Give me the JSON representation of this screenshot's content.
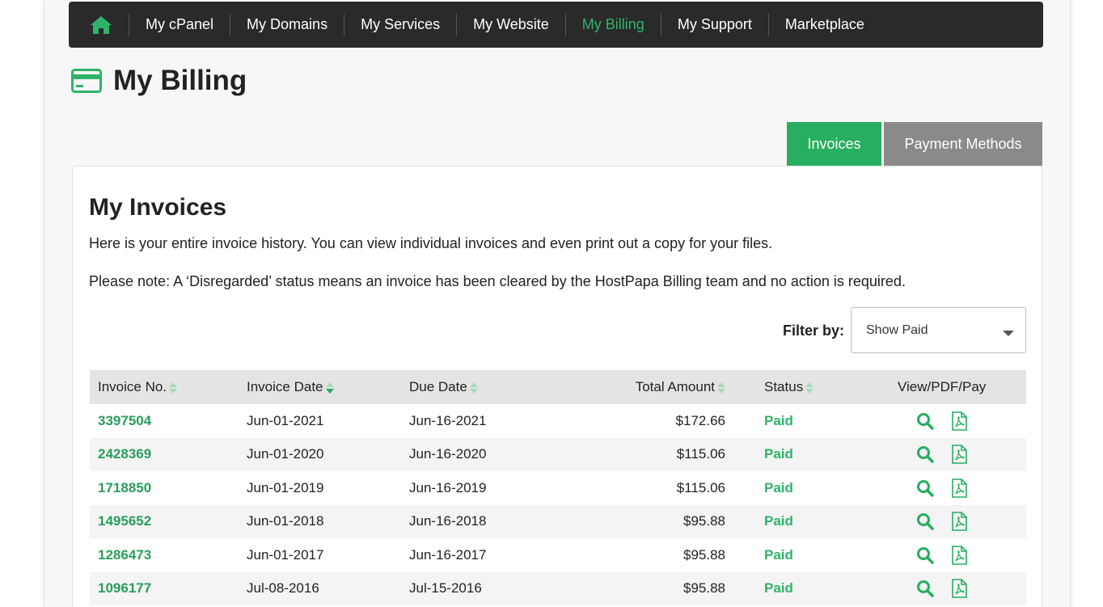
{
  "nav": {
    "home_icon": "home-icon",
    "items": [
      {
        "label": "My cPanel",
        "active": false
      },
      {
        "label": "My Domains",
        "active": false
      },
      {
        "label": "My Services",
        "active": false
      },
      {
        "label": "My Website",
        "active": false
      },
      {
        "label": "My Billing",
        "active": true
      },
      {
        "label": "My Support",
        "active": false
      },
      {
        "label": "Marketplace",
        "active": false
      }
    ]
  },
  "page": {
    "title": "My Billing",
    "icon": "credit-card-icon"
  },
  "tabs": {
    "invoices": "Invoices",
    "payment_methods": "Payment Methods"
  },
  "invoices": {
    "heading": "My Invoices",
    "description": "Here is your entire invoice history. You can view individual invoices and even print out a copy for your files.",
    "note": "Please note: A ‘Disregarded’ status means an invoice has been cleared by the HostPapa Billing team and no action is required.",
    "filter_label": "Filter by:",
    "filter_value": "Show Paid",
    "columns": {
      "invoice_no": "Invoice No.",
      "invoice_date": "Invoice Date",
      "due_date": "Due Date",
      "total_amount": "Total Amount",
      "status": "Status",
      "actions": "View/PDF/Pay"
    },
    "rows": [
      {
        "no": "3397504",
        "invoice_date": "Jun-01-2021",
        "due_date": "Jun-16-2021",
        "amount": "$172.66",
        "status": "Paid"
      },
      {
        "no": "2428369",
        "invoice_date": "Jun-01-2020",
        "due_date": "Jun-16-2020",
        "amount": "$115.06",
        "status": "Paid"
      },
      {
        "no": "1718850",
        "invoice_date": "Jun-01-2019",
        "due_date": "Jun-16-2019",
        "amount": "$115.06",
        "status": "Paid"
      },
      {
        "no": "1495652",
        "invoice_date": "Jun-01-2018",
        "due_date": "Jun-16-2018",
        "amount": "$95.88",
        "status": "Paid"
      },
      {
        "no": "1286473",
        "invoice_date": "Jun-01-2017",
        "due_date": "Jun-16-2017",
        "amount": "$95.88",
        "status": "Paid"
      },
      {
        "no": "1096177",
        "invoice_date": "Jul-08-2016",
        "due_date": "Jul-15-2016",
        "amount": "$95.88",
        "status": "Paid"
      }
    ]
  },
  "colors": {
    "accent": "#27ae60",
    "nav_bg": "#2a2a2a",
    "tab_inactive": "#8a8a8a"
  }
}
